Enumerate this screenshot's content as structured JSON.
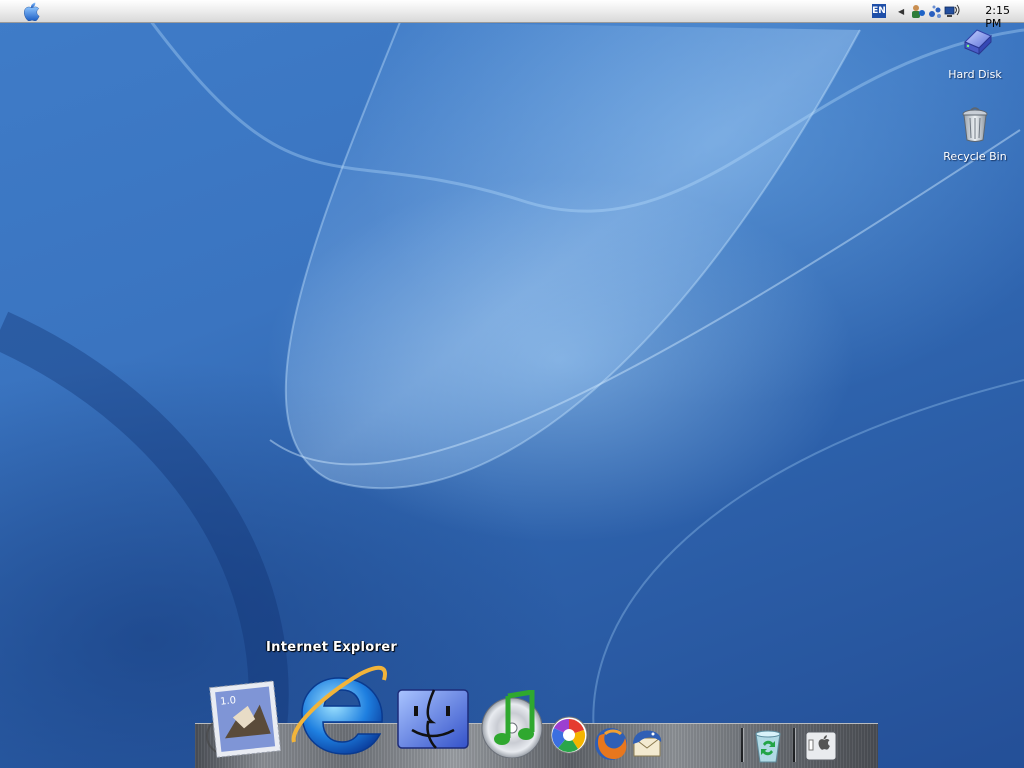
{
  "menubar": {
    "apple_menu": "apple-logo-icon",
    "tray": {
      "language": "EN",
      "icons": [
        "tray-arrow-icon",
        "user-network-icon",
        "bluetooth-icon",
        "network-connection-icon"
      ],
      "clock": "2:15 PM"
    }
  },
  "desktop": {
    "icons": [
      {
        "label": "Hard Disk",
        "icon": "hard-disk-icon"
      },
      {
        "label": "Recycle Bin",
        "icon": "recycle-bin-icon"
      }
    ]
  },
  "dock": {
    "tooltip": "Internet Explorer",
    "items": [
      {
        "name": "Mail",
        "icon": "mail-stamp-icon",
        "stamp_value": "1.0"
      },
      {
        "name": "Internet Explorer",
        "icon": "internet-explorer-icon"
      },
      {
        "name": "Finder",
        "icon": "finder-icon"
      },
      {
        "name": "iTunes",
        "icon": "itunes-icon"
      },
      {
        "name": "Picasa",
        "icon": "picasa-icon"
      },
      {
        "name": "Firefox",
        "icon": "firefox-icon"
      },
      {
        "name": "Thunderbird",
        "icon": "thunderbird-icon"
      },
      {
        "name": "Recycle Bin",
        "icon": "dock-recycle-bin-icon"
      },
      {
        "name": "Apple Menu",
        "icon": "dock-apple-panel-icon"
      }
    ]
  },
  "colors": {
    "wallpaper": "#2f5ea8",
    "menubar": "#e9e9e9",
    "label_text": "#ffffff"
  }
}
